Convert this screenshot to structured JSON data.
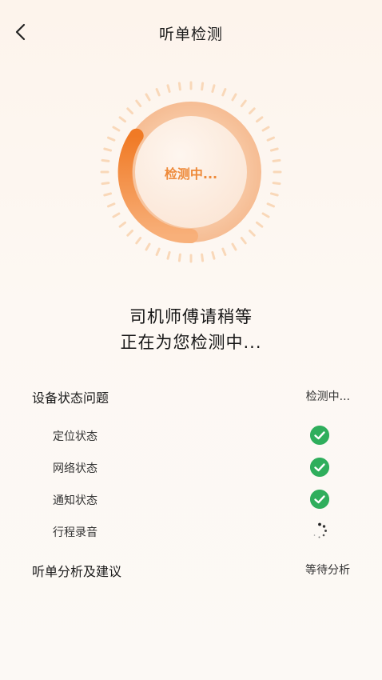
{
  "header": {
    "title": "听单检测"
  },
  "dial": {
    "label": "检测中..."
  },
  "message": {
    "line1": "司机师傅请稍等",
    "line2": "正在为您检测中..."
  },
  "device_section": {
    "title": "设备状态问题",
    "status": "检测中...",
    "items": [
      {
        "label": "定位状态",
        "state": "ok"
      },
      {
        "label": "网络状态",
        "state": "ok"
      },
      {
        "label": "通知状态",
        "state": "ok"
      },
      {
        "label": "行程录音",
        "state": "loading"
      }
    ]
  },
  "analysis_section": {
    "title": "听单分析及建议",
    "status": "等待分析"
  },
  "colors": {
    "accent": "#ee8a3a",
    "success": "#2fae5c"
  }
}
